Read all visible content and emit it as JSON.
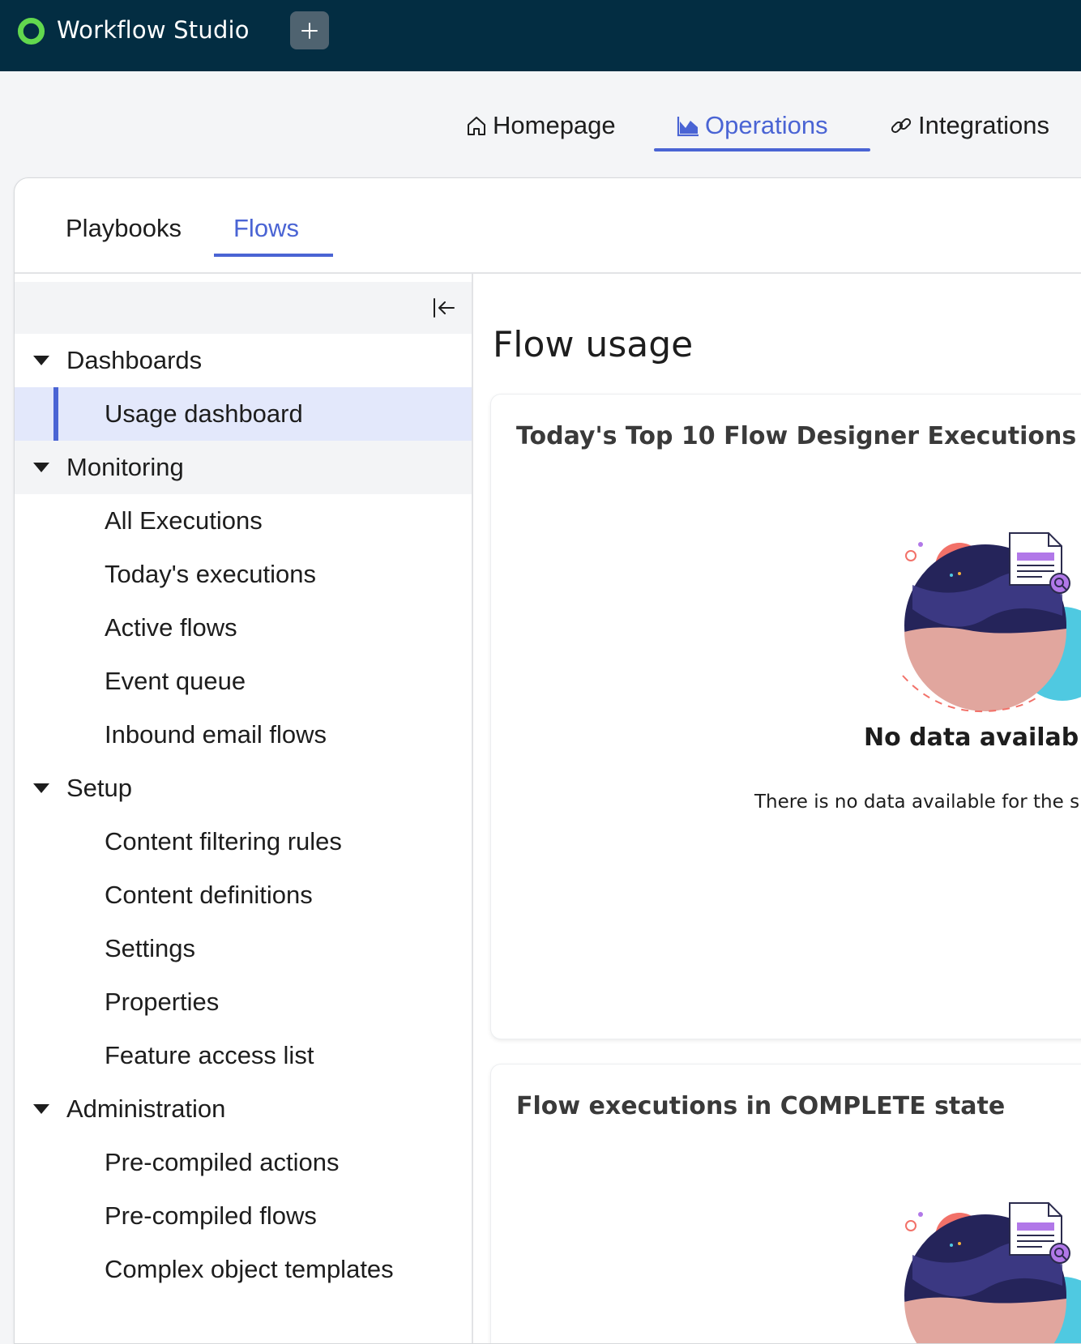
{
  "app": {
    "name": "Workflow Studio"
  },
  "primary_nav": {
    "items": [
      {
        "label": "Homepage",
        "icon": "home-icon"
      },
      {
        "label": "Operations",
        "icon": "chart-icon",
        "active": true
      },
      {
        "label": "Integrations",
        "icon": "link-icon"
      }
    ]
  },
  "subtabs": [
    {
      "label": "Playbooks"
    },
    {
      "label": "Flows",
      "active": true
    }
  ],
  "sidebar": {
    "sections": [
      {
        "label": "Dashboards",
        "items": [
          "Usage dashboard"
        ]
      },
      {
        "label": "Monitoring",
        "items": [
          "All Executions",
          "Today's executions",
          "Active flows",
          "Event queue",
          "Inbound email flows"
        ]
      },
      {
        "label": "Setup",
        "items": [
          "Content filtering rules",
          "Content definitions",
          "Settings",
          "Properties",
          "Feature access list"
        ]
      },
      {
        "label": "Administration",
        "items": [
          "Pre-compiled actions",
          "Pre-compiled flows",
          "Complex object templates"
        ]
      }
    ],
    "selected_item": "Usage dashboard"
  },
  "content": {
    "page_title": "Flow usage",
    "cards": [
      {
        "title": "Today's Top 10 Flow Designer Executions",
        "empty_title": "No data availab",
        "empty_desc": "There is no data available for the s"
      },
      {
        "title": "Flow executions in COMPLETE state"
      }
    ]
  },
  "colors": {
    "topbar": "#032d42",
    "accent": "#4a64d4",
    "selected_bg": "#e3e8fb",
    "brand_green": "#62d84e"
  }
}
